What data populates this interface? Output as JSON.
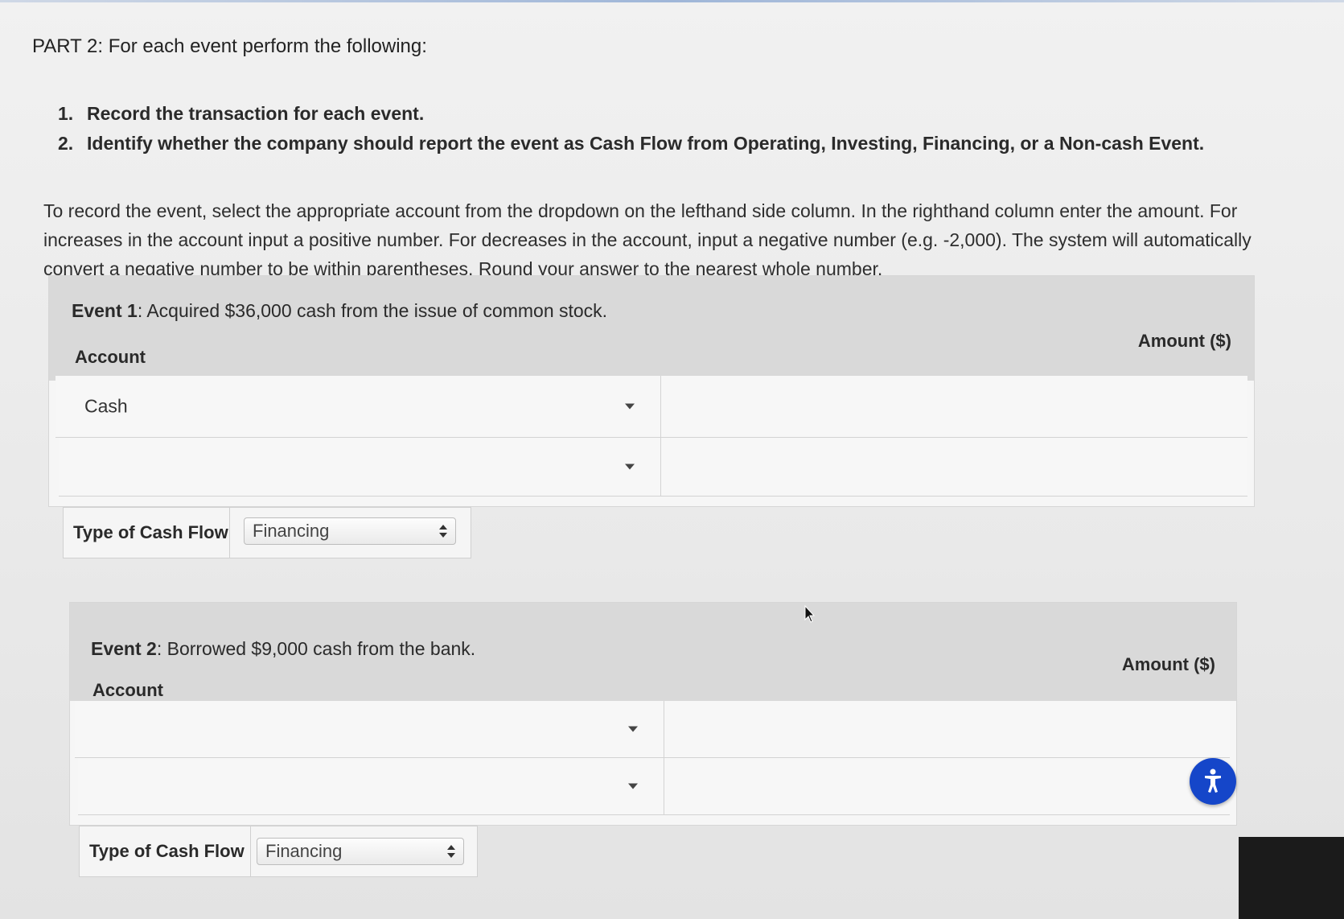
{
  "part_title": "PART 2: For each event perform the following:",
  "steps": [
    {
      "num": "1.",
      "text": "Record the transaction for each event."
    },
    {
      "num": "2.",
      "text": "Identify whether the company should report the event as Cash Flow from Operating, Investing, Financing, or a Non-cash Event."
    }
  ],
  "instructions": "To record the event, select the appropriate account from the dropdown on the lefthand side column. In the righthand column enter the amount. For increases in the account input a positive number. For decreases in the account, input a negative number (e.g. -2,000). The system will automatically convert a negative number to be within parentheses. Round your answer to the nearest whole number.",
  "events": [
    {
      "label": "Event 1",
      "description": ": Acquired $36,000 cash from the issue of common stock.",
      "account_header": "Account",
      "amount_header": "Amount ($)",
      "rows": [
        {
          "account": "Cash",
          "amount": ""
        },
        {
          "account": "",
          "amount": ""
        }
      ],
      "cash_flow_label": "Type of Cash Flow",
      "cash_flow_value": "Financing"
    },
    {
      "label": "Event 2",
      "description": ": Borrowed $9,000 cash from the bank.",
      "account_header": "Account",
      "amount_header": "Amount ($)",
      "rows": [
        {
          "account": "",
          "amount": ""
        },
        {
          "account": "",
          "amount": ""
        }
      ],
      "cash_flow_label": "Type of Cash Flow",
      "cash_flow_value": "Financing"
    }
  ],
  "icons": {
    "dropdown": "caret-down-icon",
    "select": "up-down-arrows-icon",
    "accessibility": "accessibility-icon",
    "cursor": "mouse-pointer-icon"
  },
  "colors": {
    "accessibility_button": "#1546c9",
    "header_band": "#d9d9d9"
  }
}
